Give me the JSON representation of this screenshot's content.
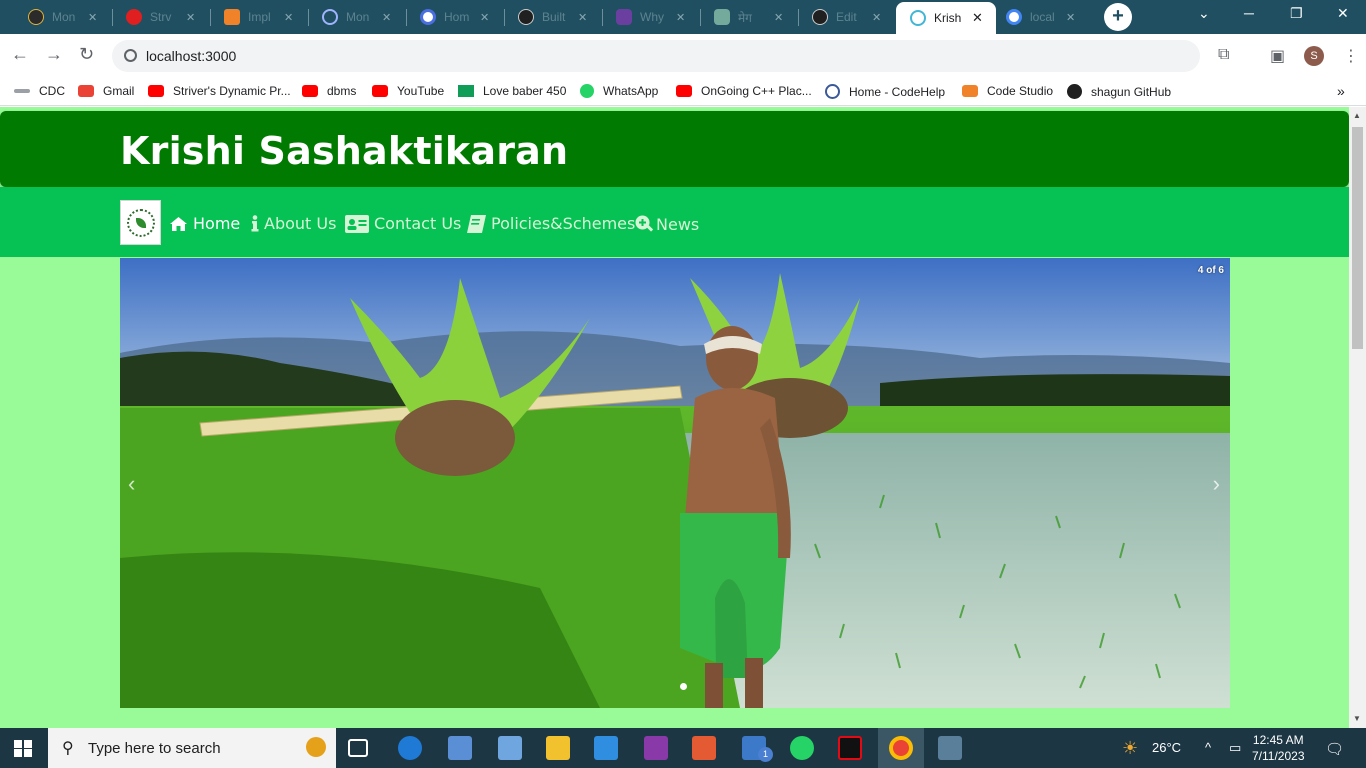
{
  "browser": {
    "tabs": [
      {
        "label": "Mon",
        "icon": "codestudio-icon",
        "color": "#2b2b2b"
      },
      {
        "label": "Strv",
        "icon": "tuf-icon",
        "color": "#e02020"
      },
      {
        "label": "Impl",
        "icon": "codingninja-icon",
        "color": "#f0822a"
      },
      {
        "label": "Mon",
        "icon": "codehelp-icon",
        "color": "#3b5998"
      },
      {
        "label": "Hom",
        "icon": "codehelp-icon",
        "color": "#4a6ee0"
      },
      {
        "label": "Built",
        "icon": "github-icon",
        "color": "#202020"
      },
      {
        "label": "Why",
        "icon": "chatgpt-icon",
        "color": "#6b3fa0"
      },
      {
        "label": "मेग",
        "icon": "chatgpt-icon",
        "color": "#74aa9c"
      },
      {
        "label": "Edit",
        "icon": "github-icon",
        "color": "#202020"
      },
      {
        "label": "Krish",
        "icon": "react-icon",
        "color": "#61dafb"
      },
      {
        "label": "local",
        "icon": "google-icon",
        "color": "#4285f4"
      }
    ],
    "active_tab_index": 9,
    "new_tab": "+",
    "url": "localhost:3000",
    "profile_initial": "S",
    "bookmarks": [
      {
        "label": "CDC",
        "color": "#9aa0a6"
      },
      {
        "label": "Gmail",
        "color": "#ea4335"
      },
      {
        "label": "Striver's Dynamic Pr...",
        "color": "#ff0000"
      },
      {
        "label": "dbms",
        "color": "#ff0000"
      },
      {
        "label": "YouTube",
        "color": "#ff0000"
      },
      {
        "label": "Love baber 450",
        "color": "#0f9d58"
      },
      {
        "label": "WhatsApp",
        "color": "#25d366"
      },
      {
        "label": "OnGoing C++ Plac...",
        "color": "#ff0000"
      },
      {
        "label": "Home - CodeHelp",
        "color": "#3b5998"
      },
      {
        "label": "Code Studio",
        "color": "#f0822a"
      },
      {
        "label": "shagun GitHub",
        "color": "#202020"
      }
    ],
    "bookmarks_more": "»"
  },
  "site": {
    "title": "Krishi Sashaktikaran",
    "nav": [
      {
        "label": "Home",
        "icon": "home-icon",
        "active": true
      },
      {
        "label": "About Us",
        "icon": "info-icon",
        "active": false
      },
      {
        "label": "Contact Us",
        "icon": "contact-card-icon",
        "active": false
      },
      {
        "label": "Policies&Schemes",
        "icon": "book-icon",
        "active": false
      },
      {
        "label": "News",
        "icon": "search-plus-icon",
        "active": false
      }
    ],
    "carousel": {
      "counter": "4 of 6",
      "slide_count": 6,
      "current": 4,
      "prev_icon": "chevron-left-icon",
      "next_icon": "chevron-right-icon"
    }
  },
  "taskbar": {
    "search_placeholder": "Type here to search",
    "weather": "26°C",
    "time": "12:45 AM",
    "date": "7/11/2023",
    "mail_badge": "1"
  }
}
